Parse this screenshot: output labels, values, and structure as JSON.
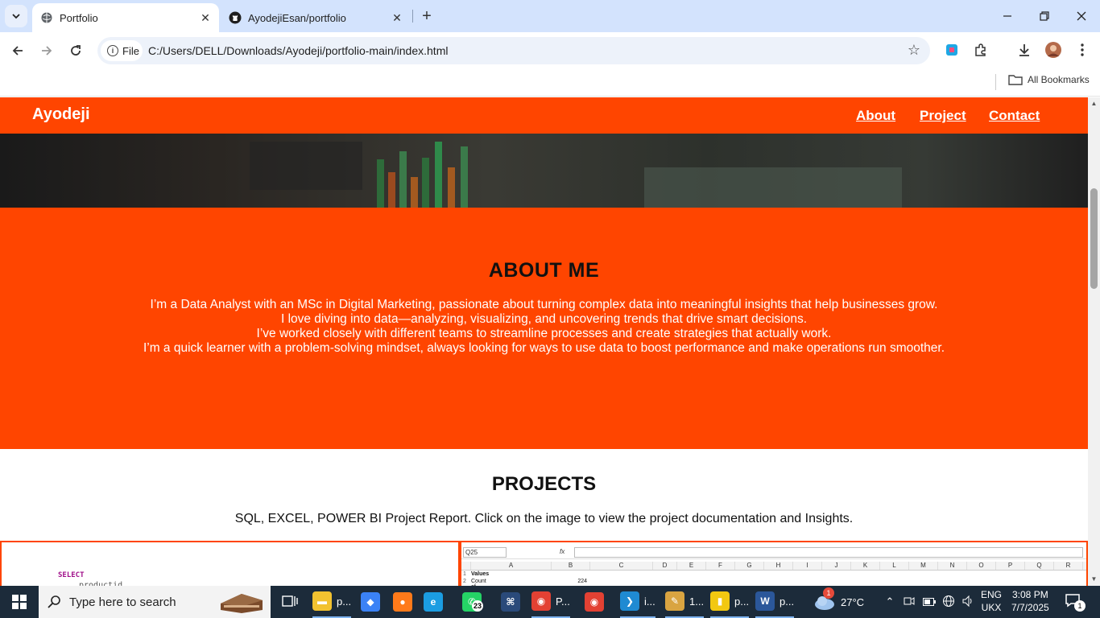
{
  "browser": {
    "tabs": [
      {
        "title": "Portfolio",
        "active": true
      },
      {
        "title": "AyodejiEsan/portfolio",
        "active": false
      }
    ],
    "url_chip": "File",
    "url": "C:/Users/DELL/Downloads/Ayodeji/portfolio-main/index.html",
    "bookmarks_label": "All Bookmarks"
  },
  "site": {
    "brand": "Ayodeji",
    "nav": [
      "About",
      "Project",
      "Contact"
    ],
    "accent_color": "#ff4500",
    "about": {
      "heading": "ABOUT ME",
      "lines": [
        "I’m a Data Analyst with an MSc in Digital Marketing, passionate about turning complex data into meaningful insights that help businesses grow.",
        "I love diving into data—analyzing, visualizing, and uncovering trends that drive smart decisions.",
        "I’ve worked closely with different teams to streamline processes and create strategies that actually work.",
        "I’m a quick learner with a problem-solving mindset, always looking for ways to use data to boost performance and make operations run smoother."
      ]
    },
    "projects": {
      "heading": "PROJECTS",
      "description": "SQL, EXCEL, POWER BI Project Report. Click on the image to view the project documentation and Insights.",
      "sql_preview": {
        "keyword": "SELECT",
        "column": "productid"
      },
      "excel_preview": {
        "name_box": "Q25",
        "columns": [
          "A",
          "B",
          "C",
          "D",
          "E",
          "F",
          "G",
          "H",
          "I",
          "J",
          "K",
          "L",
          "M",
          "N",
          "O",
          "P",
          "Q",
          "R"
        ],
        "rows": [
          {
            "n": "1",
            "a": "Values",
            "b": ""
          },
          {
            "n": "2",
            "a": "Count of User_ID",
            "b": "224"
          }
        ]
      }
    }
  },
  "taskbar": {
    "search_placeholder": "Type here to search",
    "items": [
      {
        "icon": "file-explorer-icon",
        "label": "p...",
        "color": "#f2c230"
      },
      {
        "icon": "copilot-icon",
        "label": "",
        "color": "#3b82f6"
      },
      {
        "icon": "firefox-icon",
        "label": "",
        "color": "#ff7a1a"
      },
      {
        "icon": "edge-icon",
        "label": "",
        "color": "#1b9de2"
      },
      {
        "icon": "whatsapp-icon",
        "label": "",
        "badge": "23",
        "color": "#25d366"
      },
      {
        "icon": "dev-icon",
        "label": "",
        "color": "#2a4a7a"
      },
      {
        "icon": "chrome-icon",
        "label": "P...",
        "color": "#e34133"
      },
      {
        "icon": "chrome-profile-icon",
        "label": "",
        "color": "#e34133"
      },
      {
        "icon": "vscode-icon",
        "label": "i...",
        "color": "#1f8ad2"
      },
      {
        "icon": "paint-icon",
        "label": "1...",
        "color": "#d9a441"
      },
      {
        "icon": "powerbi-icon",
        "label": "p...",
        "color": "#f2c811"
      },
      {
        "icon": "word-icon",
        "label": "p...",
        "color": "#2b579a"
      }
    ],
    "weather": {
      "temp": "27°C",
      "badge": "1"
    },
    "language": [
      "ENG",
      "UKX"
    ],
    "time": "3:08 PM",
    "date": "7/7/2025",
    "notification_count": "1"
  }
}
